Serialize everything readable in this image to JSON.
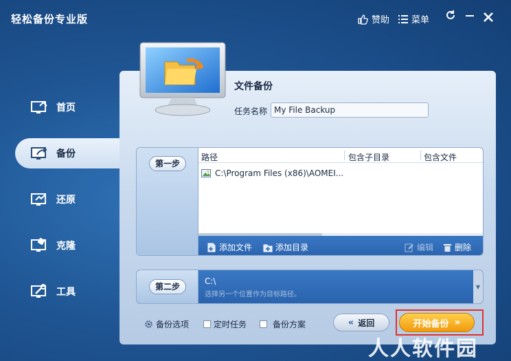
{
  "app": {
    "title": "轻松备份专业版"
  },
  "titlebar": {
    "sponsor": "赞助",
    "menu": "菜单"
  },
  "sidebar": {
    "items": [
      {
        "label": "首页",
        "icon": "home-monitor-icon",
        "active": false
      },
      {
        "label": "备份",
        "icon": "backup-monitor-icon",
        "active": true
      },
      {
        "label": "还原",
        "icon": "restore-monitor-icon",
        "active": false
      },
      {
        "label": "克隆",
        "icon": "clone-monitor-icon",
        "active": false
      },
      {
        "label": "工具",
        "icon": "tools-monitor-icon",
        "active": false
      }
    ]
  },
  "main": {
    "section_title": "文件备份",
    "task_label": "任务名称",
    "task_value": "My File Backup"
  },
  "step1": {
    "label": "第一步",
    "columns": [
      "路径",
      "包含子目录",
      "包含文件"
    ],
    "rows": [
      {
        "path": "C:\\Program Files (x86)\\AOMEI..."
      }
    ],
    "actions": {
      "add_file": "添加文件",
      "add_dir": "添加目录",
      "edit": "编辑",
      "delete": "删除"
    }
  },
  "step2": {
    "label": "第二步",
    "path": "C:\\",
    "hint": "选择另一个位置作为目标路径。"
  },
  "bottom": {
    "options": "备份选项",
    "schedule": "定时任务",
    "scheme": "备份方案",
    "back": "返回",
    "start": "开始备份"
  },
  "watermark": "人人软件园",
  "colors": {
    "accent": "#f19a0d",
    "panel": "#c9daee",
    "highlight": "#e0312a"
  }
}
